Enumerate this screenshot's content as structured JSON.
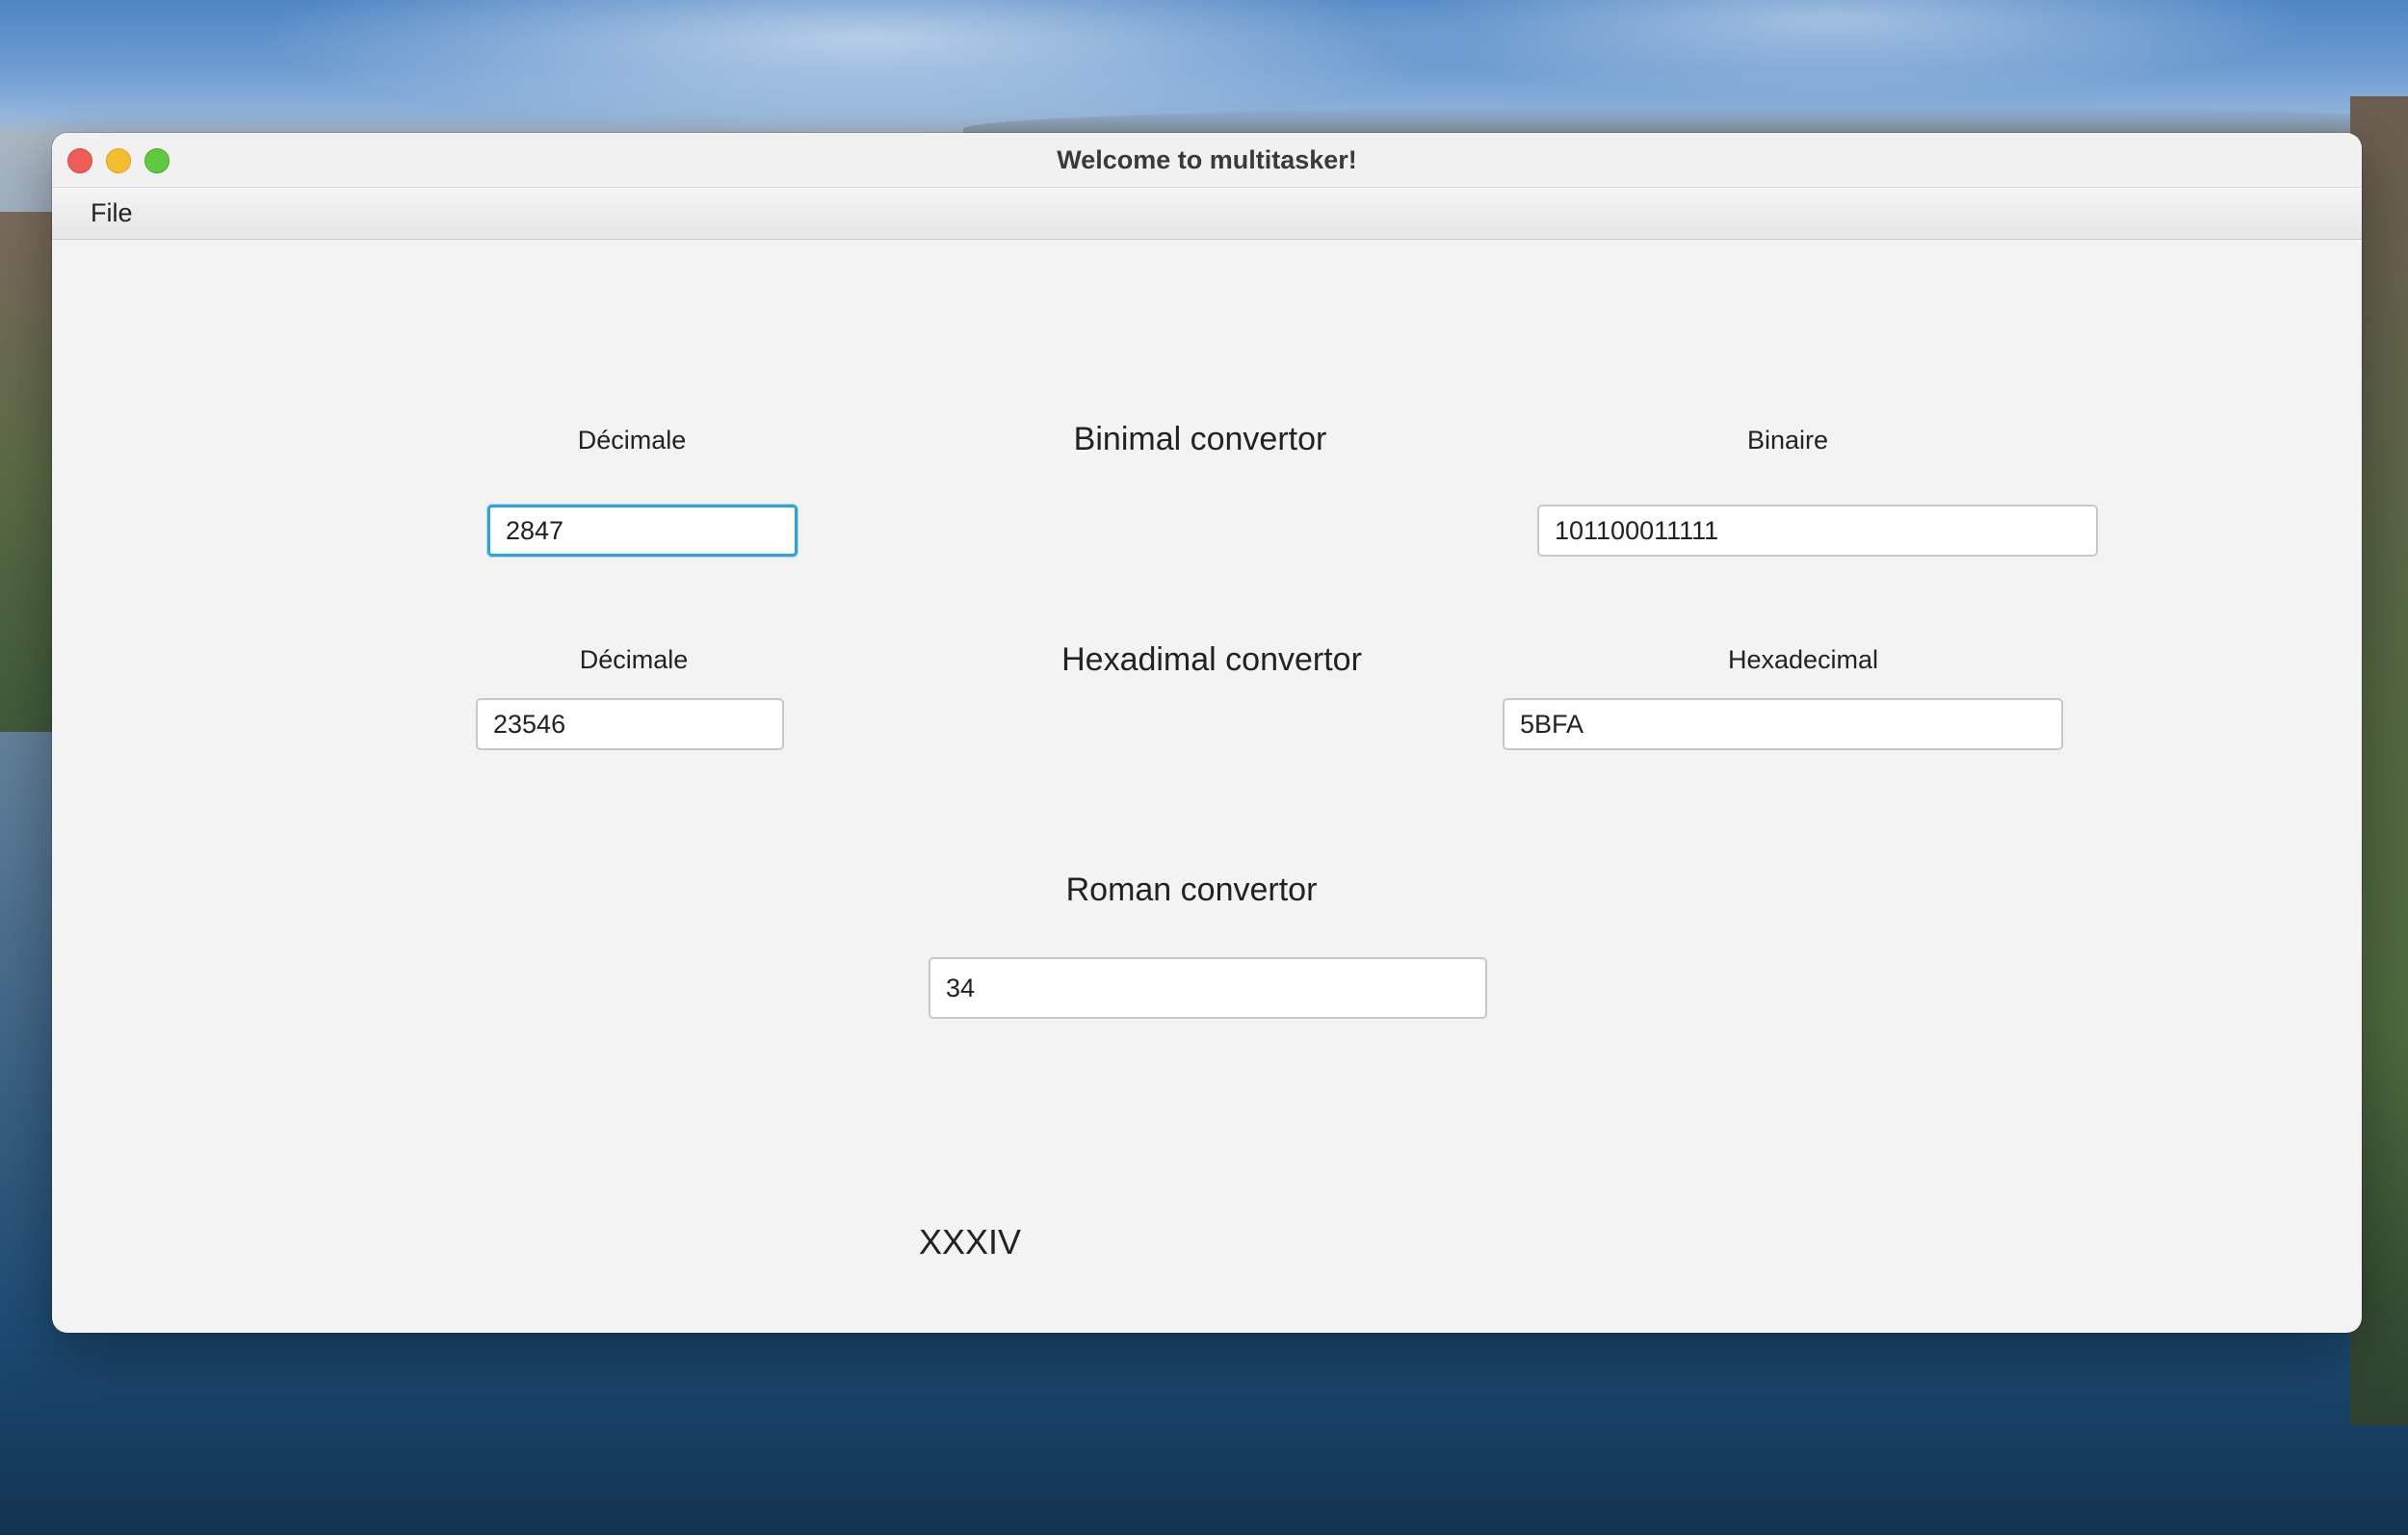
{
  "window": {
    "title": "Welcome to multitasker!"
  },
  "menubar": {
    "file_label": "File"
  },
  "binary_converter": {
    "title": "Binimal convertor",
    "decimal_label": "Décimale",
    "binary_label": "Binaire",
    "decimal_value": "2847",
    "binary_value": "101100011111"
  },
  "hex_converter": {
    "title": "Hexadimal convertor",
    "decimal_label": "Décimale",
    "hex_label": "Hexadecimal",
    "decimal_value": "23546",
    "hex_value": "5BFA"
  },
  "roman_converter": {
    "title": "Roman convertor",
    "input_value": "34",
    "result": "XXXIV"
  },
  "colors": {
    "focus_ring": "#2aa4de",
    "window_bg": "#f3f3f3",
    "close": "#ee5e57",
    "minimize": "#f5bd2f",
    "maximize": "#5fc93f"
  }
}
